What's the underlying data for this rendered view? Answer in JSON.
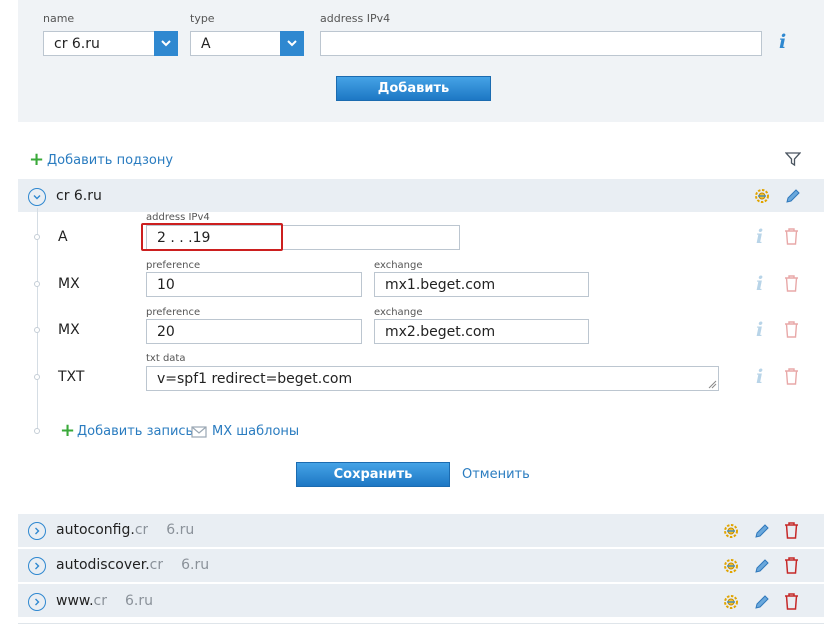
{
  "add_form": {
    "name_label": "name",
    "name_value": "cr  6.ru",
    "type_label": "type",
    "type_value": "A",
    "address_label": "address IPv4",
    "address_value": "",
    "add_button": "Добавить"
  },
  "subzone_link": "Добавить подзону",
  "zone": {
    "name": "cr  6.ru",
    "records": [
      {
        "type": "A",
        "label1": "address IPv4",
        "value1": "2 .  .  .19"
      },
      {
        "type": "MX",
        "label1": "preference",
        "value1": "10",
        "label2": "exchange",
        "value2": "mx1.beget.com"
      },
      {
        "type": "MX",
        "label1": "preference",
        "value1": "20",
        "label2": "exchange",
        "value2": "mx2.beget.com"
      },
      {
        "type": "TXT",
        "label1": "txt data",
        "value1": "v=spf1 redirect=beget.com"
      }
    ],
    "add_record_link": "Добавить запись",
    "mx_templates_link": "MX шаблоны",
    "save_button": "Сохранить",
    "cancel_link": "Отменить"
  },
  "subzones": [
    {
      "prefix": "autoconfig.",
      "suffix_a": "cr",
      "suffix_b": "6.ru"
    },
    {
      "prefix": "autodiscover.",
      "suffix_a": "cr",
      "suffix_b": "6.ru"
    },
    {
      "prefix": "www.",
      "suffix_a": "cr",
      "suffix_b": "6.ru"
    }
  ],
  "colors": {
    "accent": "#2f88d0",
    "panel": "#f0f3f6",
    "highlight": "#cc1f1f",
    "plus": "#3aa93a"
  }
}
